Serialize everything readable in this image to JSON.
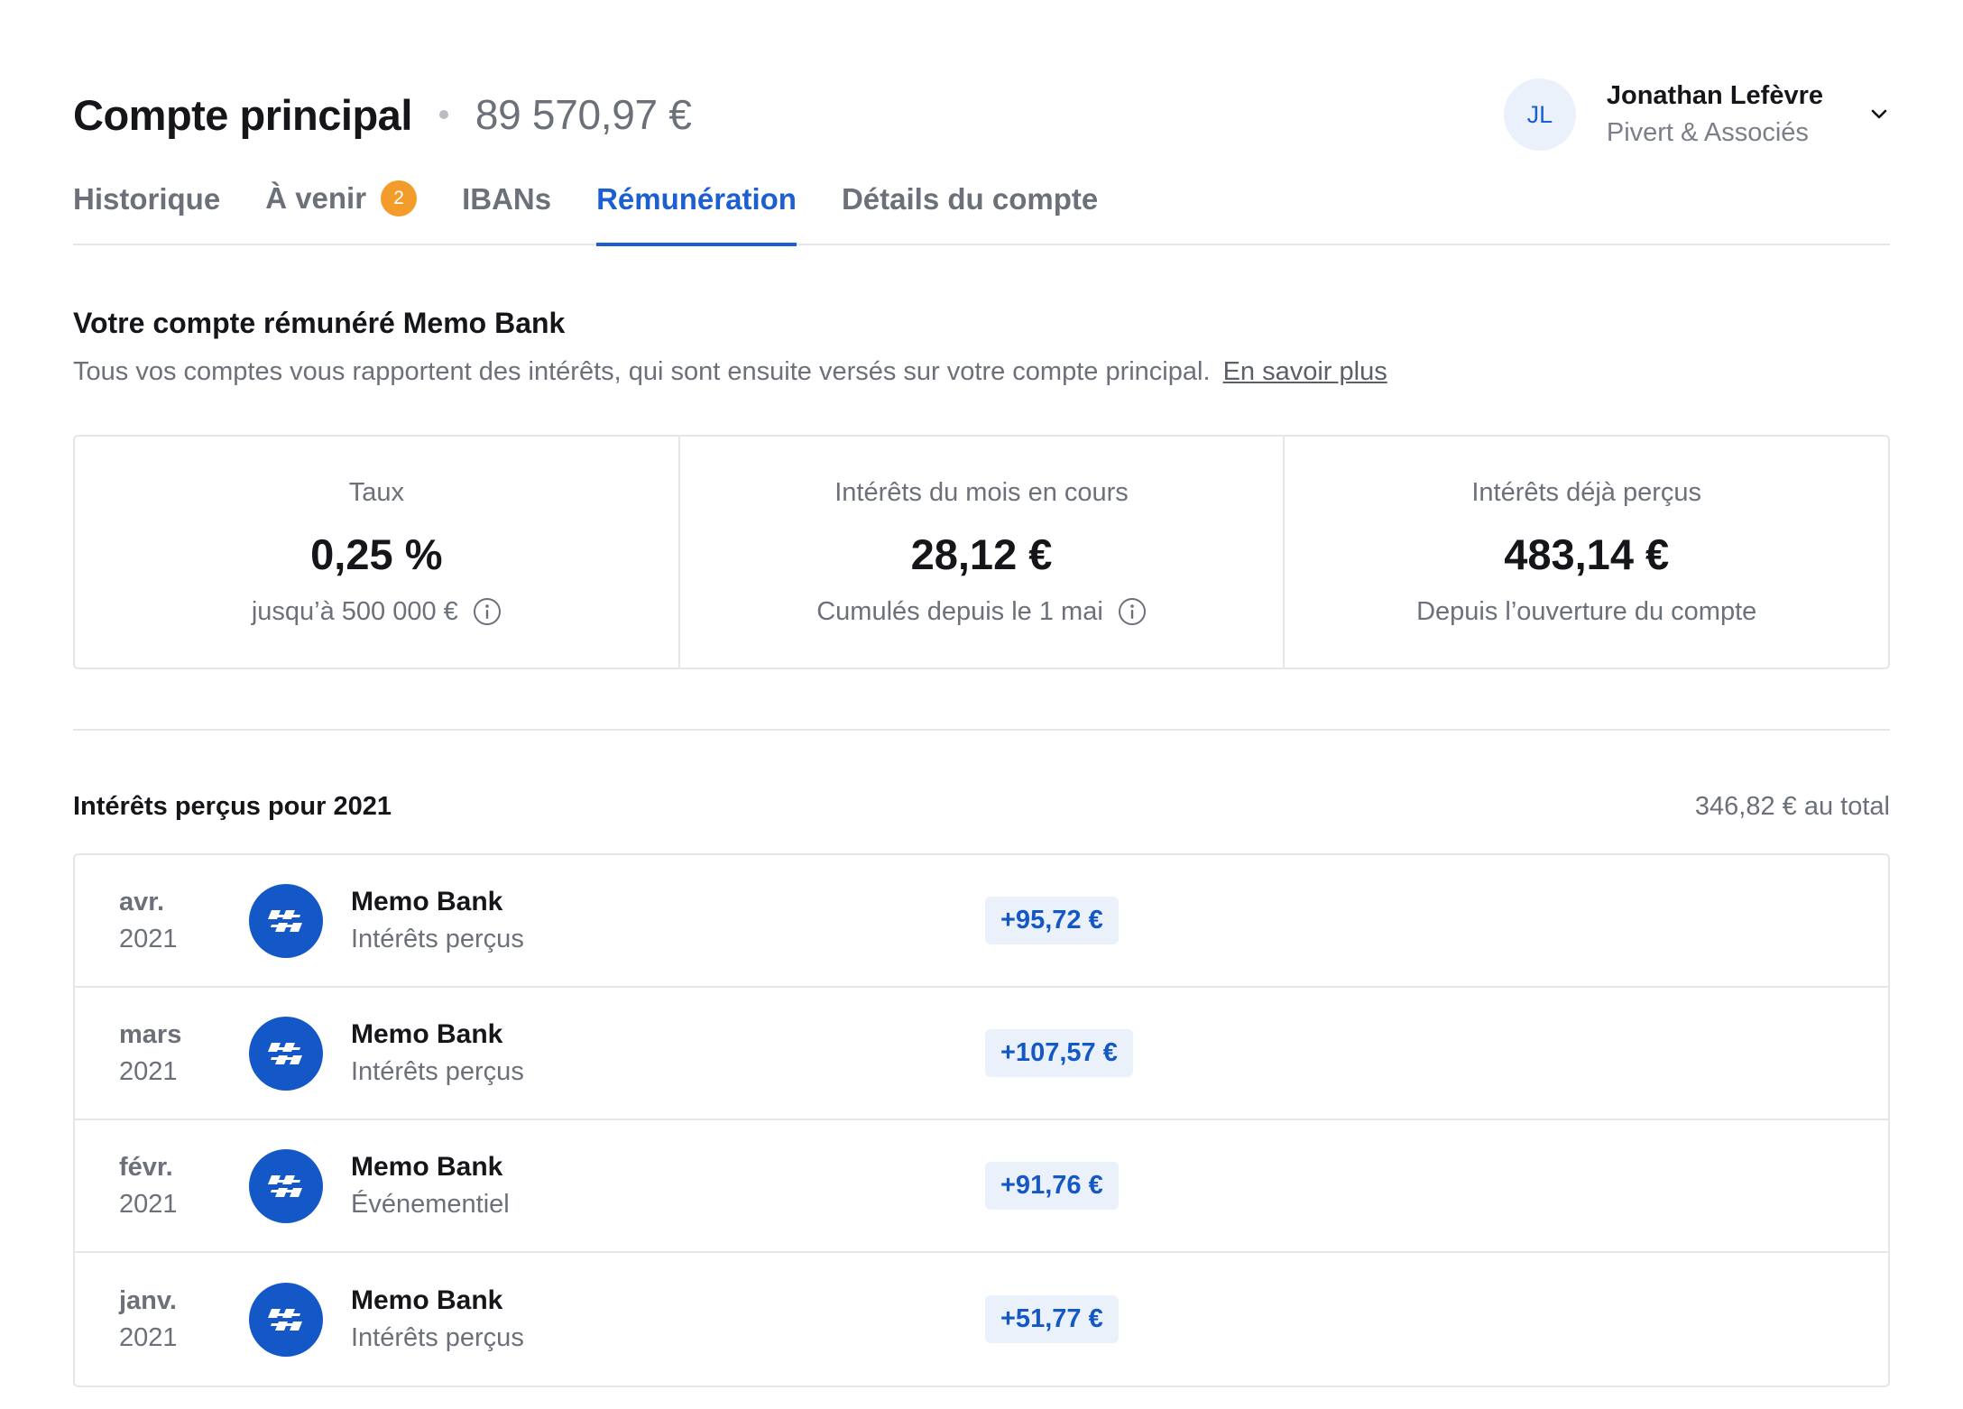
{
  "header": {
    "title": "Compte principal",
    "balance": "89 570,97 €",
    "user": {
      "initials": "JL",
      "name": "Jonathan Lefèvre",
      "company": "Pivert & Associés"
    }
  },
  "tabs": [
    {
      "label": "Historique"
    },
    {
      "label": "À venir",
      "badge": "2"
    },
    {
      "label": "IBANs"
    },
    {
      "label": "Rémunération",
      "active": true
    },
    {
      "label": "Détails du compte"
    }
  ],
  "section": {
    "title": "Votre compte rémunéré Memo Bank",
    "description": "Tous vos comptes vous rapportent des intérêts, qui sont ensuite versés sur votre compte principal.",
    "link": "En savoir plus"
  },
  "stats": [
    {
      "label": "Taux",
      "value": "0,25 %",
      "sub": "jusqu’à 500 000 €",
      "info": true
    },
    {
      "label": "Intérêts du mois en cours",
      "value": "28,12 €",
      "sub": "Cumulés depuis le 1 mai",
      "info": true
    },
    {
      "label": "Intérêts déjà perçus",
      "value": "483,14 €",
      "sub": "Depuis l’ouverture du compte",
      "info": false
    }
  ],
  "list": {
    "title": "Intérêts perçus pour 2021",
    "total": "346,82 € au total",
    "rows": [
      {
        "month": "avr.",
        "year": "2021",
        "name": "Memo Bank",
        "desc": "Intérêts perçus",
        "amount": "+95,72 €"
      },
      {
        "month": "mars",
        "year": "2021",
        "name": "Memo Bank",
        "desc": "Intérêts perçus",
        "amount": "+107,57 €"
      },
      {
        "month": "févr.",
        "year": "2021",
        "name": "Memo Bank",
        "desc": "Événementiel",
        "amount": "+91,76 €"
      },
      {
        "month": "janv.",
        "year": "2021",
        "name": "Memo Bank",
        "desc": "Intérêts perçus",
        "amount": "+51,77 €"
      }
    ]
  },
  "colors": {
    "accent": "#1b5fd3",
    "badge": "#f39c2b",
    "amount_bg": "#eaf1fb"
  },
  "icons": {
    "user_menu": "chevron-down-icon",
    "info": "info-icon",
    "row_logo": "memo-bank-logo-icon"
  }
}
